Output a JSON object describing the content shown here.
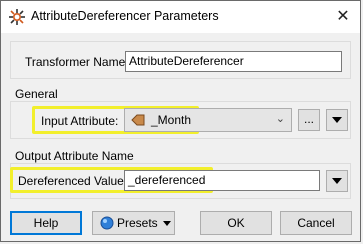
{
  "window": {
    "title": "AttributeDereferencer Parameters",
    "close_symbol": "✕"
  },
  "transformer": {
    "label": "Transformer Name:",
    "value": "AttributeDereferencer"
  },
  "general": {
    "group_label": "General",
    "input_label": "Input Attribute:",
    "input_value": "_Month",
    "input_icon": "attribute-icon",
    "ellipsis_label": "..."
  },
  "output": {
    "group_label": "Output Attribute Name",
    "deref_label": "Dereferenced Value:",
    "deref_value": "_dereferenced"
  },
  "buttons": {
    "help": "Help",
    "presets": "Presets",
    "ok": "OK",
    "cancel": "Cancel"
  },
  "colors": {
    "highlight": "#f2ef2c",
    "attribute_icon": "#c98a4b"
  }
}
